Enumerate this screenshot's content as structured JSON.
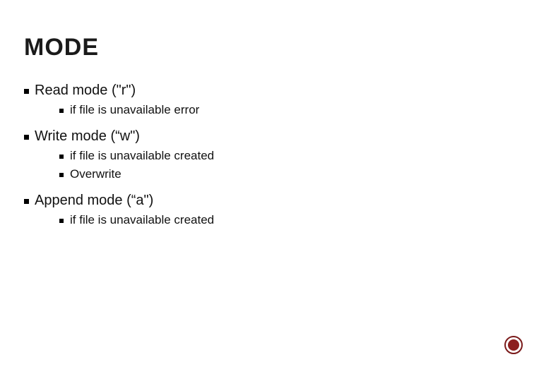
{
  "title": "MODE",
  "items": [
    {
      "label": "Read mode (\"r\")",
      "children": [
        {
          "label": "if file is unavailable error"
        }
      ]
    },
    {
      "label": "Write mode (“w\")",
      "children": [
        {
          "label": "if file is unavailable created"
        },
        {
          "label": "Overwrite"
        }
      ]
    },
    {
      "label": "Append mode (“a\")",
      "children": [
        {
          "label": "if file is unavailable created"
        }
      ]
    }
  ]
}
